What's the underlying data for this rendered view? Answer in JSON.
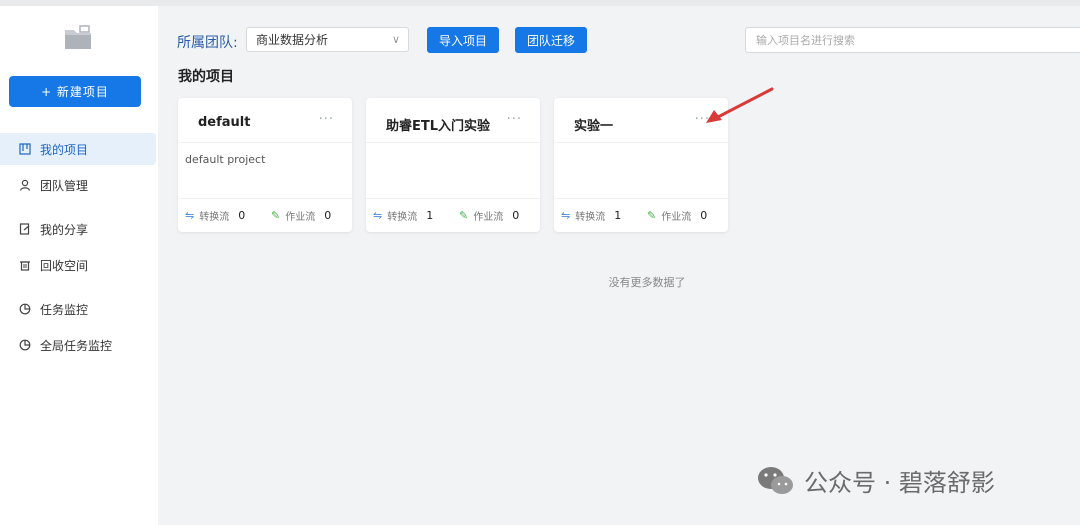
{
  "sidebar": {
    "new_button": "+ 新建项目",
    "items": [
      {
        "label": "我的项目",
        "icon": "board-icon",
        "active": true
      },
      {
        "label": "团队管理",
        "icon": "user-icon",
        "active": false
      },
      {
        "label": "我的分享",
        "icon": "share-doc-icon",
        "active": false
      },
      {
        "label": "回收空间",
        "icon": "trash-icon",
        "active": false
      },
      {
        "label": "任务监控",
        "icon": "pie-chart-icon",
        "active": false
      },
      {
        "label": "全局任务监控",
        "icon": "pie-chart-icon",
        "active": false
      }
    ]
  },
  "toolbar": {
    "team_label": "所属团队:",
    "team_selected": "商业数据分析",
    "import_button": "导入项目",
    "migrate_button": "团队迁移",
    "search_placeholder": "输入项目名进行搜索"
  },
  "main": {
    "section_title": "我的项目",
    "projects": [
      {
        "name": "default",
        "description": "default project",
        "transform_label": "转换流",
        "transform_count": "0",
        "job_label": "作业流",
        "job_count": "0"
      },
      {
        "name": "助睿ETL入门实验",
        "description": "",
        "transform_label": "转换流",
        "transform_count": "1",
        "job_label": "作业流",
        "job_count": "0"
      },
      {
        "name": "实验一",
        "description": "",
        "transform_label": "转换流",
        "transform_count": "1",
        "job_label": "作业流",
        "job_count": "0"
      }
    ],
    "more_label": "···",
    "no_more": "没有更多数据了"
  },
  "watermark": {
    "text": "公众号 · 碧落舒影",
    "icon": "wechat-icon"
  },
  "colors": {
    "accent": "#1677e6",
    "active_bg": "#e6f0fb",
    "arrow": "#d93a3a"
  }
}
